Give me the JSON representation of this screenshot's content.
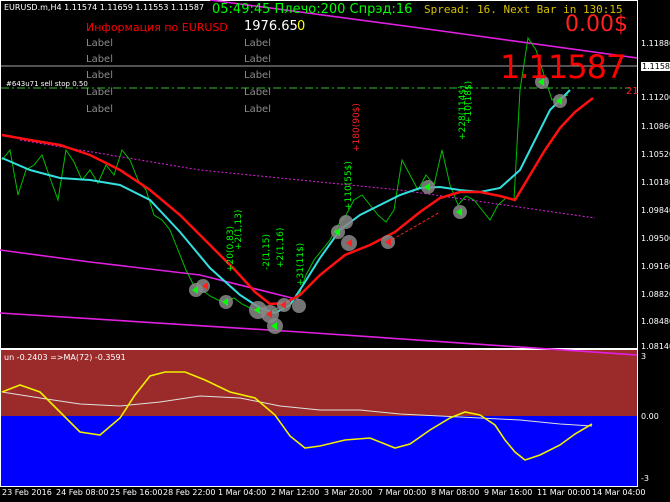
{
  "header": {
    "symbol_info": "EURUSD.m,H4  1.11574 1.11659 1.11553 1.11587",
    "clock_line": "05:49:45 Плечо:200 Спрэд:16",
    "info_label": "Информация по EURUSD",
    "balance": "1976.65",
    "balance_suffix": "0",
    "spread_line": "Spread: 16. Next Bar in 130:15",
    "profit": "0.00$",
    "big_price": "1.11587",
    "right_marker": "21",
    "order_line": "#643u71 sell stop 0.50"
  },
  "labels": {
    "col1": [
      "Label",
      "Label",
      "Label",
      "Label",
      "Label"
    ],
    "col2": [
      "Label",
      "Label",
      "Label",
      "Label",
      "Label"
    ]
  },
  "price_axis": [
    "1.11880",
    "1.11587",
    "1.11200",
    "1.10860",
    "1.10520",
    "1.10180",
    "1.09840",
    "1.09500",
    "1.09160",
    "1.08820",
    "1.08480",
    "1.08140"
  ],
  "current_price_tag": "1.11587",
  "indicator": {
    "title": "un -0.2403  =>MA(72) -0.3591",
    "axis": [
      "3",
      "0.00",
      "-3"
    ]
  },
  "time_axis": [
    "23 Feb 2016",
    "24 Feb 08:00",
    "25 Feb 16:00",
    "28 Feb 22:00",
    "1 Mar 04:00",
    "2 Mar 12:00",
    "3 Mar 20:00",
    "7 Mar 00:00",
    "8 Mar 08:00",
    "9 Mar 16:00",
    "11 Mar 00:00",
    "14 Mar 04:00"
  ],
  "trade_annotations": [
    {
      "text": "+2(1,13)",
      "color": "#00ff00"
    },
    {
      "text": "+20(0,83)",
      "color": "#00ff00"
    },
    {
      "text": "-2(1,15)",
      "color": "#00ff00"
    },
    {
      "text": "+2(1,16)",
      "color": "#00ff00"
    },
    {
      "text": "+31(11$)",
      "color": "#00ff00"
    },
    {
      "text": "+110(55$)",
      "color": "#00ff00"
    },
    {
      "text": "+180(90$)",
      "color": "#ff2020"
    },
    {
      "text": "+228(114$)",
      "color": "#00ff00"
    },
    {
      "text": "+10(18$)",
      "color": "#00ff00"
    }
  ],
  "colors": {
    "background": "#000000",
    "price_line": "#00c000",
    "cyan_ma": "#33e0e0",
    "red_ma": "#ff1010",
    "channel": "#e020e0",
    "indicator_upper": "#9b2a2a",
    "indicator_lower": "#0000ff",
    "oscillator": "#f0f000",
    "oscillator_ma": "#e0e0e0"
  }
}
